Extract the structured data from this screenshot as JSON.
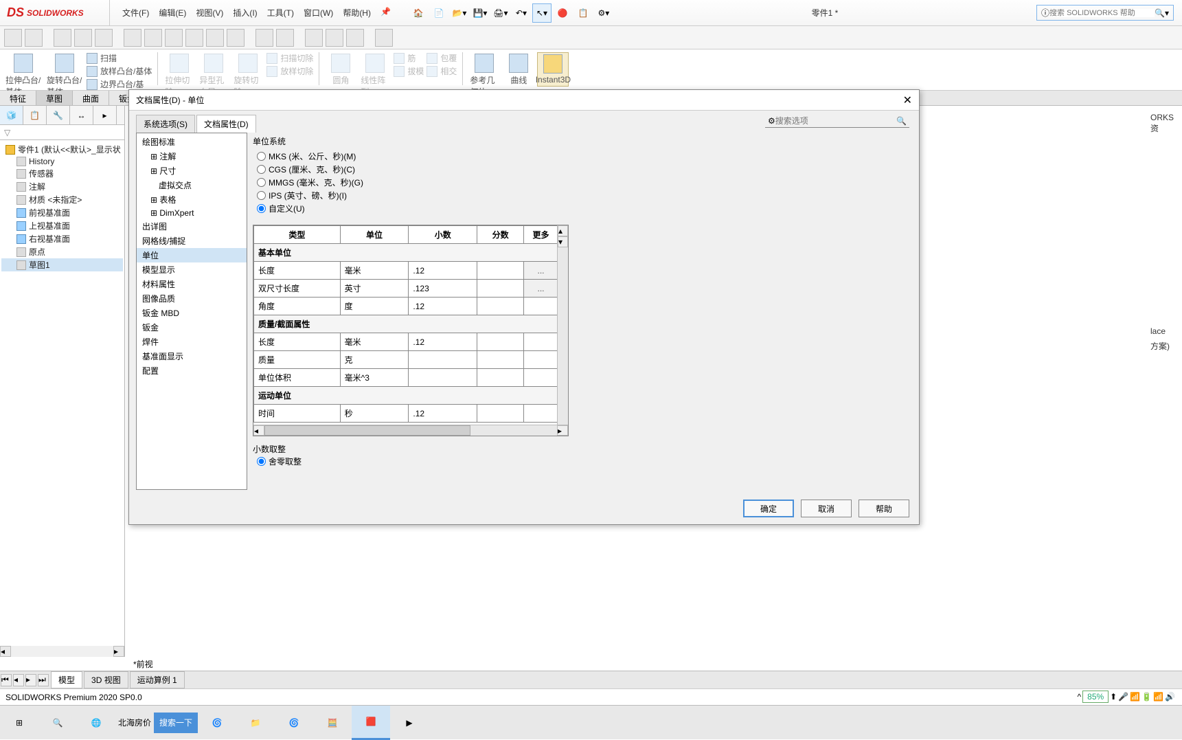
{
  "app": {
    "logo": "SOLIDWORKS",
    "doc_title": "零件1 *",
    "search_placeholder": "搜索 SOLIDWORKS 帮助"
  },
  "menu": [
    "文件(F)",
    "编辑(E)",
    "视图(V)",
    "插入(I)",
    "工具(T)",
    "窗口(W)",
    "帮助(H)"
  ],
  "ribbon": {
    "extrude": "拉伸凸台/基体",
    "revolve": "旋转凸台/基体",
    "sweep": "扫描",
    "loft": "放样凸台/基体",
    "boundary": "边界凸台/基",
    "extrude_cut": "拉伸切除",
    "wizard": "异型孔向导",
    "revolve_cut": "旋转切除",
    "sweep_cut": "扫描切除",
    "loft_cut": "放样切除",
    "fillet": "圆角",
    "pattern": "线性阵列",
    "rib": "筋",
    "draft": "拔模",
    "wrap": "包覆",
    "intersect": "相交",
    "refgeom": "参考几何体",
    "curves": "曲线",
    "instant3d": "Instant3D"
  },
  "cmtabs": [
    "特征",
    "草图",
    "曲面",
    "钣金"
  ],
  "fm": {
    "root": "零件1 (默认<<默认>_显示状",
    "items": [
      "History",
      "传感器",
      "注解",
      "材质 <未指定>",
      "前视基准面",
      "上视基准面",
      "右视基准面",
      "原点",
      "草图1"
    ]
  },
  "dialog": {
    "title": "文档属性(D) - 单位",
    "tabs": [
      "系统选项(S)",
      "文档属性(D)"
    ],
    "search_placeholder": "搜索选项",
    "nav": [
      "绘图标准",
      "注解",
      "尺寸",
      "虚拟交点",
      "表格",
      "DimXpert",
      "出详图",
      "网格线/捕捉",
      "单位",
      "模型显示",
      "材料属性",
      "图像品质",
      "钣金 MBD",
      "钣金",
      "焊件",
      "基准面显示",
      "配置"
    ],
    "nav_selected": "单位",
    "unit_system": {
      "label": "单位系统",
      "opts": [
        "MKS (米、公斤、秒)(M)",
        "CGS (厘米、克、秒)(C)",
        "MMGS (毫米、克、秒)(G)",
        "IPS (英寸、磅、秒)(I)",
        "自定义(U)"
      ],
      "selected": 4
    },
    "table": {
      "headers": [
        "类型",
        "单位",
        "小数",
        "分数",
        "更多"
      ],
      "sections": [
        {
          "title": "基本单位",
          "rows": [
            {
              "type": "长度",
              "unit": "毫米",
              "dec": ".12",
              "frac": "",
              "more": "..."
            },
            {
              "type": "双尺寸长度",
              "unit": "英寸",
              "dec": ".123",
              "frac": "",
              "more": "..."
            },
            {
              "type": "角度",
              "unit": "度",
              "dec": ".12",
              "frac": "",
              "more": ""
            }
          ]
        },
        {
          "title": "质量/截面属性",
          "rows": [
            {
              "type": "长度",
              "unit": "毫米",
              "dec": ".12",
              "frac": "",
              "more": ""
            },
            {
              "type": "质量",
              "unit": "克",
              "dec": "",
              "frac": "",
              "more": ""
            },
            {
              "type": "单位体积",
              "unit": "毫米^3",
              "dec": "",
              "frac": "",
              "more": ""
            }
          ]
        },
        {
          "title": "运动单位",
          "rows": [
            {
              "type": "时间",
              "unit": "秒",
              "dec": ".12",
              "frac": "",
              "more": ""
            }
          ]
        }
      ]
    },
    "rounding": {
      "label": "小数取整",
      "opt": "舍零取整"
    },
    "buttons": {
      "ok": "确定",
      "cancel": "取消",
      "help": "帮助"
    }
  },
  "right_hints": [
    "ORKS 资",
    "lace",
    "方案)"
  ],
  "view_strip": "*前视",
  "bottom_tabs": [
    "模型",
    "3D 视图",
    "运动算例 1"
  ],
  "status": "SOLIDWORKS Premium 2020 SP0.0",
  "status_pct": "85%",
  "taskbar": {
    "search_btn": "搜索一下",
    "text": "北海房价"
  }
}
